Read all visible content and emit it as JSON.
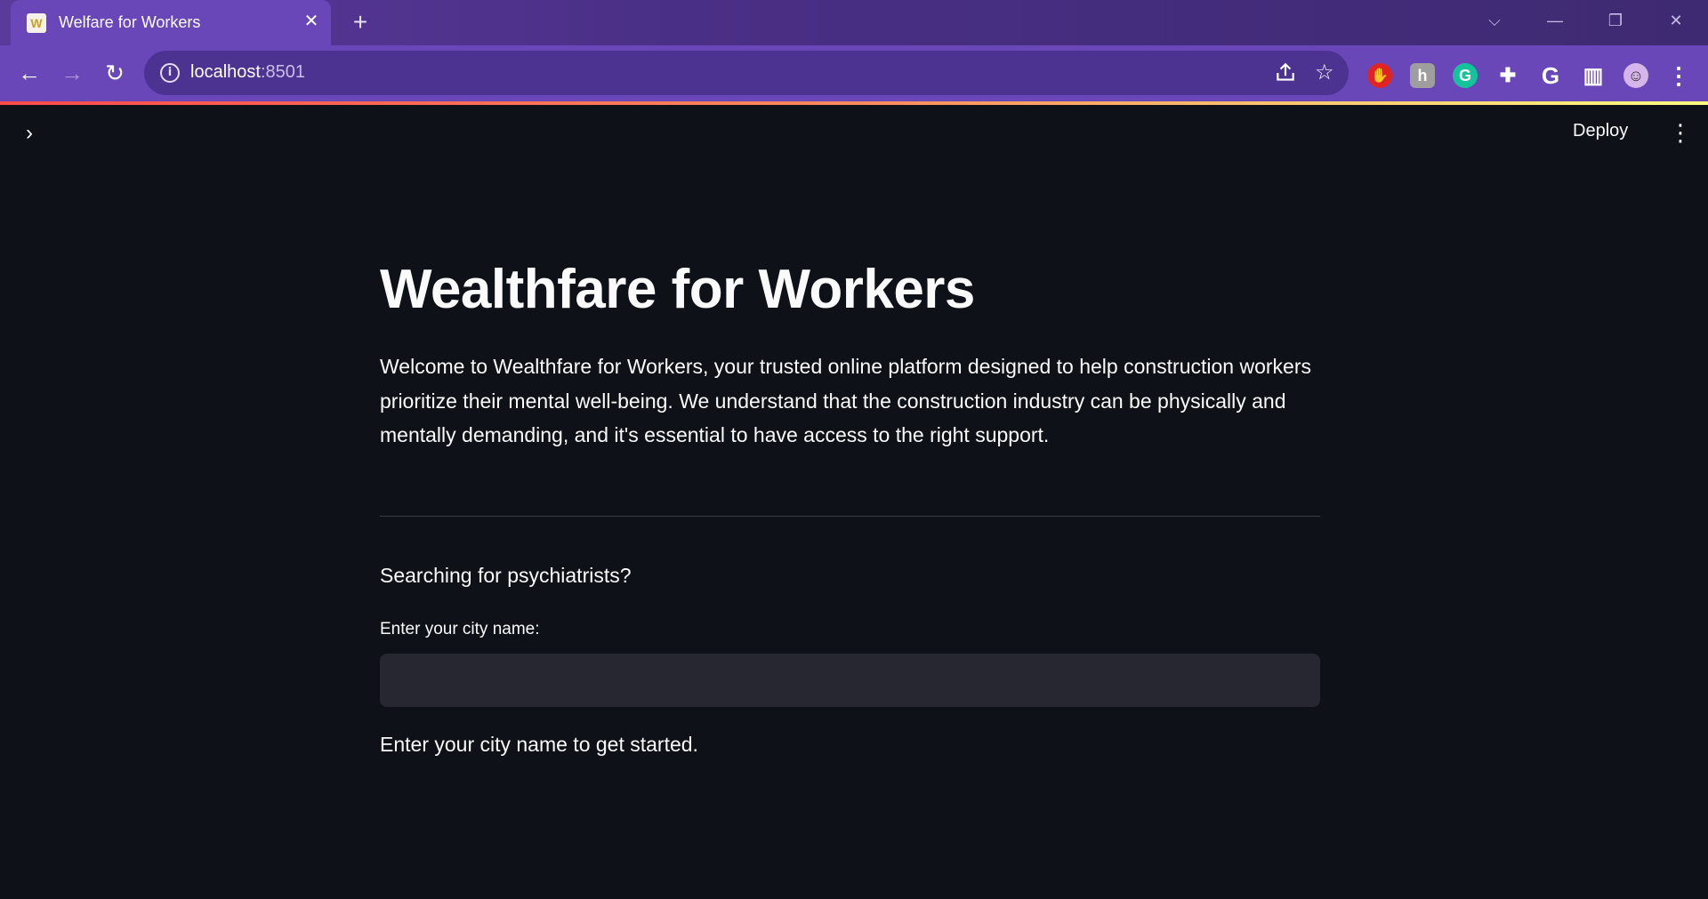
{
  "browser": {
    "tab": {
      "title": "Welfare for Workers",
      "favicon_letter": "W",
      "close_glyph": "✕"
    },
    "new_tab_glyph": "+",
    "window_controls": {
      "tabsearch": "⌵",
      "minimize": "—",
      "restore": "❐",
      "close": "✕"
    },
    "nav": {
      "back": "←",
      "forward": "→",
      "reload": "↻"
    },
    "address": {
      "host": "localhost",
      "port": ":8501"
    },
    "omnibox_icons": [
      "info-icon",
      "share-icon",
      "star-icon"
    ],
    "extensions": [
      {
        "name": "adblock-icon",
        "glyph": "✋",
        "bg": "#e02424"
      },
      {
        "name": "extension-h-icon",
        "glyph": "h",
        "bg": "#9e9e9e"
      },
      {
        "name": "grammarly-icon",
        "glyph": "G",
        "bg": "#15c39a"
      },
      {
        "name": "puzzle-icon",
        "glyph": "✚",
        "bg": "transparent"
      },
      {
        "name": "google-icon",
        "glyph": "G",
        "bg": "transparent"
      },
      {
        "name": "side-panel-icon",
        "glyph": "▥",
        "bg": "transparent"
      },
      {
        "name": "profile-avatar-icon",
        "glyph": "☺",
        "bg": "#d6b6ea"
      },
      {
        "name": "chrome-menu-icon",
        "glyph": "⋮",
        "bg": "transparent"
      }
    ]
  },
  "app": {
    "sidebar_toggle": "›",
    "deploy_label": "Deploy",
    "menu_glyph": "⋮",
    "title": "Wealthfare for Workers",
    "intro": "Welcome to Wealthfare for Workers, your trusted online platform designed to help construction workers prioritize their mental well-being. We understand that the construction industry can be physically and mentally demanding, and it's essential to have access to the right support.",
    "search_heading": "Searching for psychiatrists?",
    "city_label": "Enter your city name:",
    "city_value": "",
    "hint": "Enter your city name to get started."
  },
  "colors": {
    "app_bg": "#0e1117",
    "text": "#fafafa",
    "input_bg": "#262730",
    "chrome_purple": "#6a47b8"
  }
}
